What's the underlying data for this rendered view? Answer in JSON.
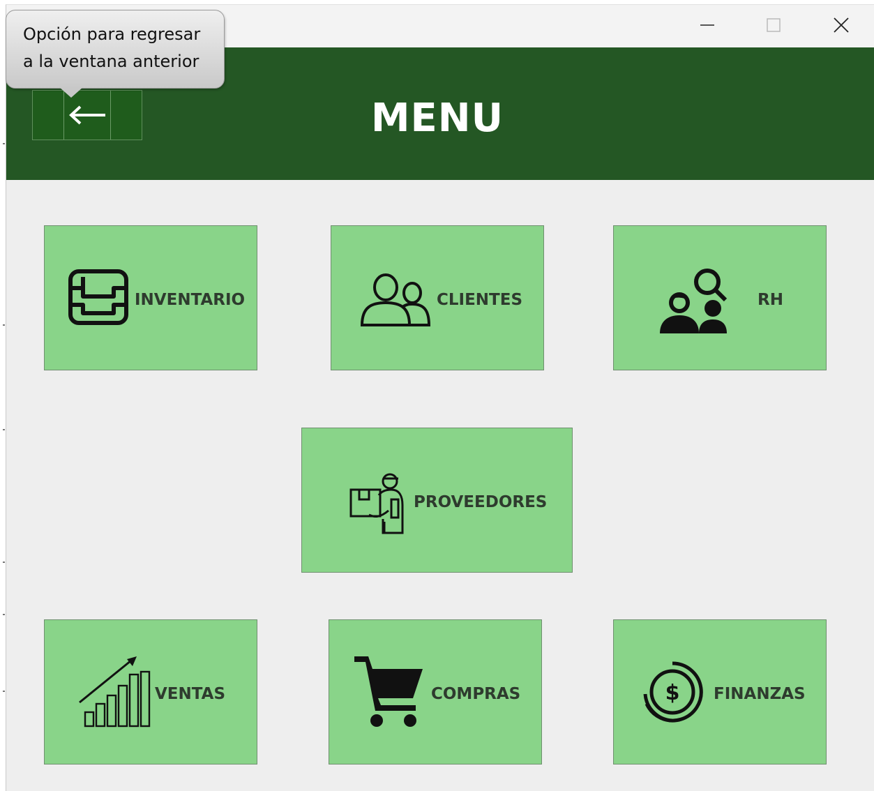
{
  "window": {
    "controls": {
      "minimize_icon": "minimize-icon",
      "maximize_icon": "maximize-icon",
      "close_icon": "close-icon"
    }
  },
  "header": {
    "title": "MENU",
    "back_button_icon": "arrow-left-icon",
    "background_color": "#245724"
  },
  "tooltip": {
    "text": "Opción para regresar\na la ventana anterior"
  },
  "menu": {
    "tile_color": "#89d489",
    "items": [
      {
        "label": "INVENTARIO",
        "icon": "archive-box-icon"
      },
      {
        "label": "CLIENTES",
        "icon": "users-icon"
      },
      {
        "label": "RH",
        "icon": "user-search-icon"
      },
      {
        "label": "PROVEEDORES",
        "icon": "delivery-person-icon"
      },
      {
        "label": "VENTAS",
        "icon": "growth-chart-icon"
      },
      {
        "label": "COMPRAS",
        "icon": "shopping-cart-icon"
      },
      {
        "label": "FINANZAS",
        "icon": "dollar-coin-icon"
      }
    ]
  }
}
